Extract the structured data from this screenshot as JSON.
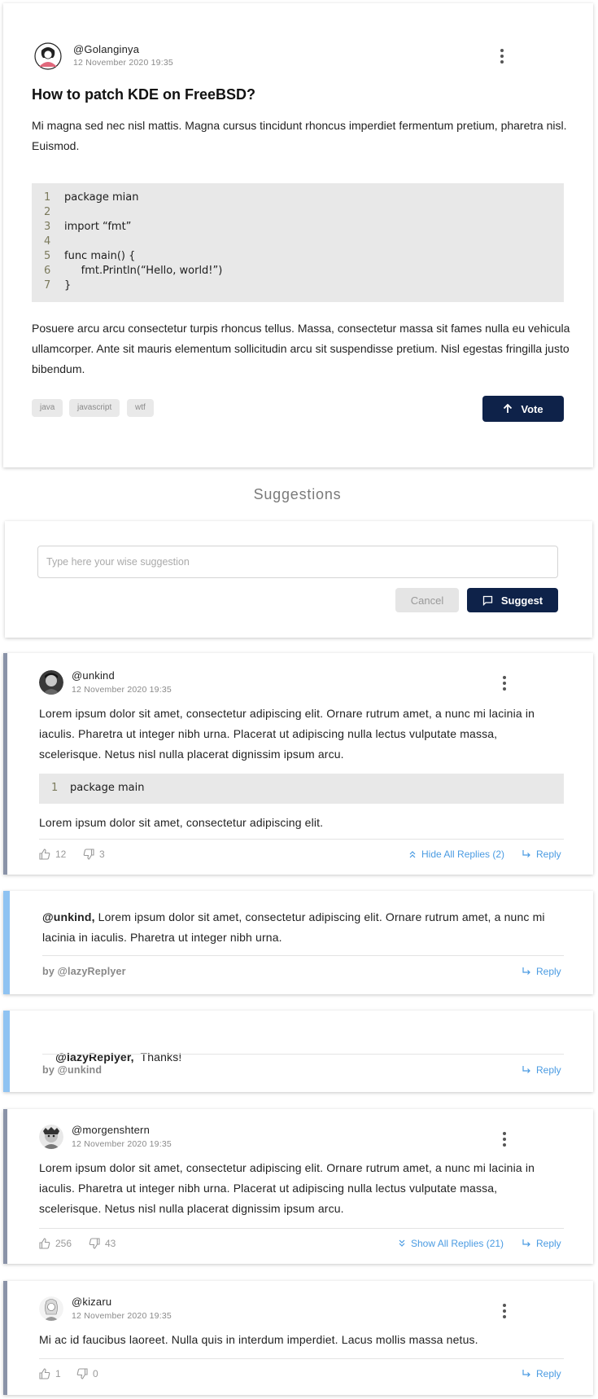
{
  "post": {
    "username": "@Golanginya",
    "date": "12 November 2020 19:35",
    "title": "How to patch KDE on FreeBSD?",
    "intro": "Mi magna sed nec nisl mattis. Magna cursus tincidunt rhoncus imperdiet fermentum pretium, pharetra nisl. Euismod.",
    "code_lines": [
      {
        "n": "1",
        "text": "package mian"
      },
      {
        "n": "2",
        "text": ""
      },
      {
        "n": "3",
        "text": "import “fmt”"
      },
      {
        "n": "4",
        "text": ""
      },
      {
        "n": "5",
        "text": "func main() {"
      },
      {
        "n": "6",
        "text": "     fmt.Println(“Hello, world!”)"
      },
      {
        "n": "7",
        "text": "}"
      }
    ],
    "body": "Posuere arcu arcu consectetur turpis rhoncus tellus. Massa, consectetur massa sit fames nulla eu vehicula ullamcorper. Ante sit mauris elementum sollicitudin arcu sit suspendisse pretium. Nisl egestas fringilla justo bibendum.",
    "tags": [
      "java",
      "javascript",
      "wtf"
    ],
    "vote_label": "Vote"
  },
  "suggestions": {
    "title": "Suggestions",
    "placeholder": "Type here your wise suggestion",
    "cancel_label": "Cancel",
    "suggest_label": "Suggest"
  },
  "comments": [
    {
      "username": "@unkind",
      "date": "12 November 2020 19:35",
      "text": "Lorem ipsum dolor sit amet, consectetur adipiscing elit. Ornare rutrum amet, a nunc mi lacinia in iaculis. Pharetra ut integer nibh urna. Placerat ut adipiscing nulla lectus vulputate massa, scelerisque. Netus nisl nulla placerat dignissim ipsum arcu.",
      "code_line": {
        "n": "1",
        "text": "package main"
      },
      "text_after": "Lorem ipsum dolor sit amet, consectetur adipiscing elit.",
      "likes": "12",
      "dislikes": "3",
      "replies_toggle": "Hide All Replies (2)",
      "reply_label": "Reply"
    },
    {
      "username": "@morgenshtern",
      "date": "12 November 2020 19:35",
      "text": "Lorem ipsum dolor sit amet, consectetur adipiscing elit. Ornare rutrum amet, a nunc mi lacinia in iaculis. Pharetra ut integer nibh urna. Placerat ut adipiscing nulla lectus vulputate massa, scelerisque. Netus nisl nulla placerat dignissim ipsum arcu.",
      "likes": "256",
      "dislikes": "43",
      "replies_toggle": "Show All Replies (21)",
      "reply_label": "Reply"
    },
    {
      "username": "@kizaru",
      "date": "12 November 2020 19:35",
      "text": "Mi ac id faucibus laoreet. Nulla quis in interdum imperdiet. Lacus mollis massa netus.",
      "likes": "1",
      "dislikes": "0",
      "reply_label": "Reply"
    }
  ],
  "replies": [
    {
      "mention": "@unkind,",
      "text": " Lorem ipsum dolor sit amet, consectetur adipiscing elit. Ornare rutrum amet, a nunc mi lacinia in iaculis. Pharetra ut integer nibh urna.",
      "byline": "by @lazyReplyer",
      "reply_label": "Reply"
    },
    {
      "mention": "@lazyReplyer,",
      "text": "  Thanks!",
      "byline": "by @unkind",
      "reply_label": "Reply"
    }
  ],
  "colors": {
    "primary": "#0e2249",
    "link": "#4a9be2",
    "comment_bar": "#8a93a8",
    "reply_bar": "#8fc3f2",
    "code_bg": "#e8e8e8"
  }
}
